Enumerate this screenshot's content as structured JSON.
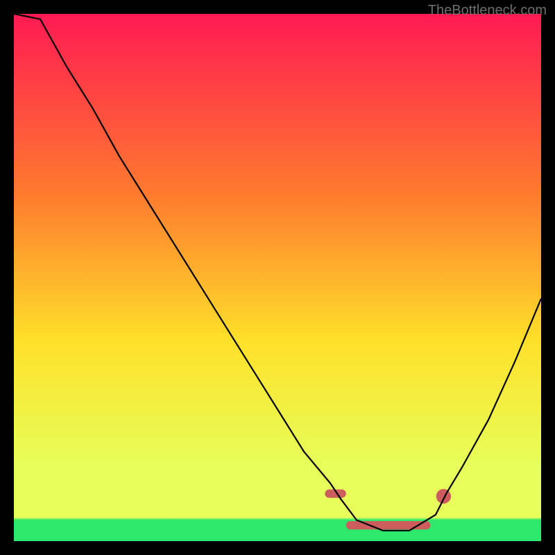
{
  "attribution": "TheBottleneck.com",
  "chart_data": {
    "type": "line",
    "title": "",
    "xlabel": "",
    "ylabel": "",
    "xlim": [
      0,
      100
    ],
    "ylim": [
      0,
      100
    ],
    "background_gradient": {
      "top": "#ff1a52",
      "upper_mid": "#ff7a2f",
      "mid": "#ffe02a",
      "lower": "#e6ff5a",
      "bottom_band": "#2ee86b"
    },
    "series": [
      {
        "name": "bottleneck-curve",
        "x": [
          0,
          5,
          10,
          15,
          20,
          25,
          30,
          35,
          40,
          45,
          50,
          55,
          60,
          62,
          65,
          70,
          75,
          80,
          82,
          85,
          90,
          95,
          100
        ],
        "y": [
          100,
          99,
          90,
          82,
          73,
          65,
          57,
          49,
          41,
          33,
          25,
          17,
          11,
          8,
          4,
          2,
          2,
          5,
          9,
          14,
          23,
          34,
          46
        ],
        "stroke": "#000000",
        "width": 2.2
      }
    ],
    "highlights": [
      {
        "name": "trough-segment-left",
        "shape": "rounded-bar",
        "x0": 59,
        "x1": 63,
        "y": 9,
        "color": "#cd5c5c"
      },
      {
        "name": "trough-segment-mid",
        "shape": "rounded-bar",
        "x0": 63,
        "x1": 79,
        "y": 3,
        "color": "#cd5c5c"
      },
      {
        "name": "trough-segment-right",
        "shape": "dot",
        "x": 81.5,
        "y": 8.5,
        "r": 1.4,
        "color": "#cd5c5c"
      }
    ]
  }
}
